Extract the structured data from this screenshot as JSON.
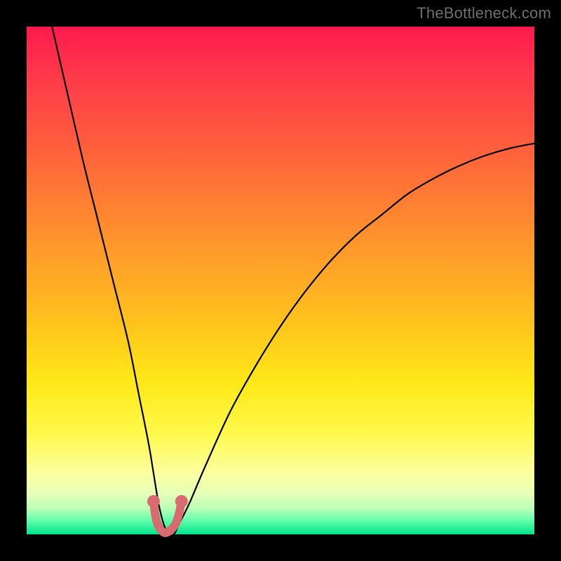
{
  "watermark": "TheBottleneck.com",
  "chart_data": {
    "type": "line",
    "title": "",
    "xlabel": "",
    "ylabel": "",
    "xlim": [
      0,
      100
    ],
    "ylim": [
      0,
      100
    ],
    "series": [
      {
        "name": "bottleneck-curve",
        "x": [
          5,
          8,
          11,
          14,
          17,
          20,
          22,
          24,
          25,
          26,
          27,
          28,
          29,
          30,
          32,
          35,
          40,
          45,
          50,
          55,
          60,
          65,
          70,
          75,
          80,
          85,
          90,
          95,
          100
        ],
        "y": [
          100,
          87,
          74,
          62,
          50,
          38,
          28,
          18,
          12,
          6,
          2,
          0,
          0,
          2,
          6,
          13,
          24,
          33,
          41,
          48,
          54,
          59,
          63,
          67,
          70,
          72.5,
          74.5,
          76,
          77
        ]
      },
      {
        "name": "highlight-segment",
        "x": [
          25.0,
          25.3,
          25.8,
          26.5,
          27.3,
          28.3,
          29.3,
          30.0,
          30.5
        ],
        "y": [
          6.5,
          4.0,
          2.0,
          0.8,
          0.3,
          0.8,
          2.0,
          4.0,
          6.5
        ]
      }
    ],
    "colors": {
      "curve": "#000000",
      "highlight": "#d96a6f",
      "highlight_dot": "#d96a6f"
    }
  }
}
